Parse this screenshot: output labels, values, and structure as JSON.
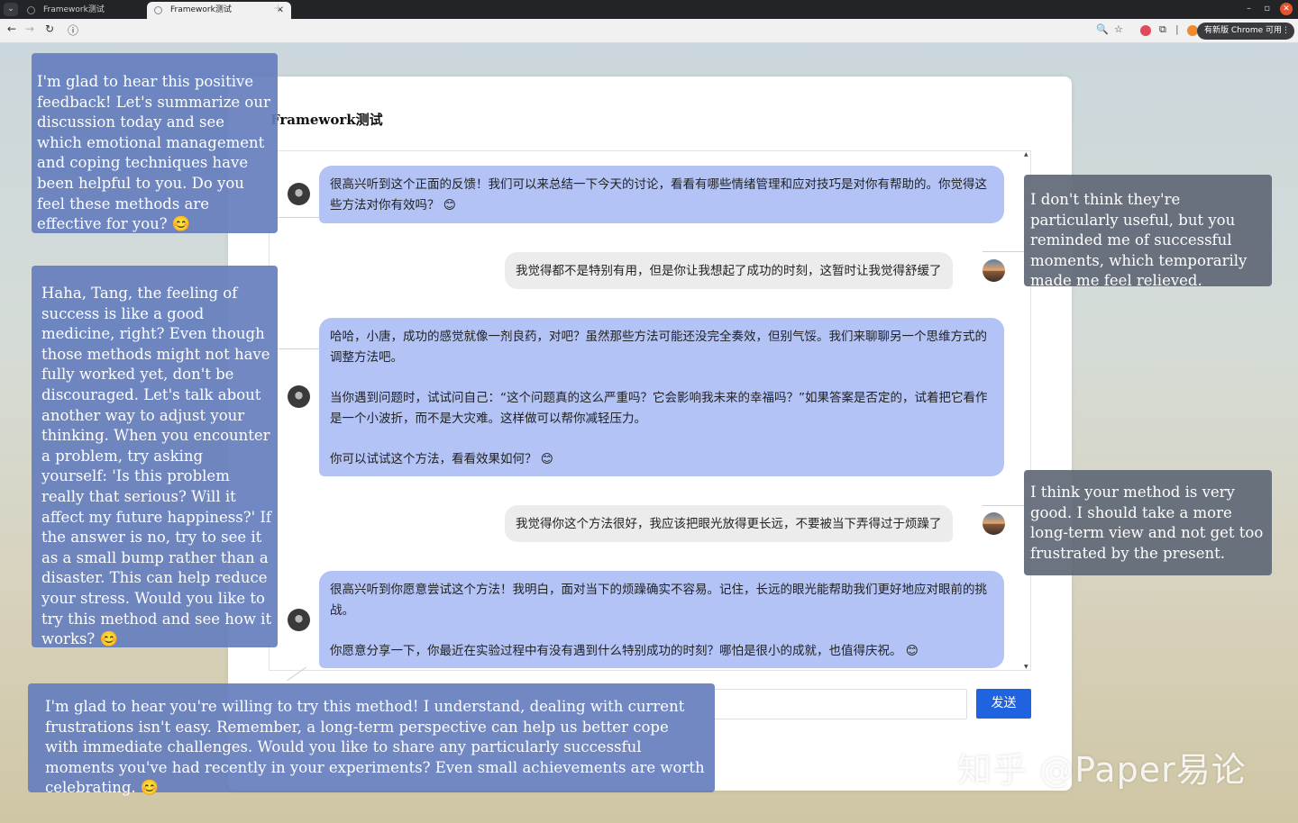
{
  "browser": {
    "tabs": [
      {
        "title": "Framework测试",
        "active": false
      },
      {
        "title": "Framework测试",
        "active": true
      }
    ],
    "update_pill": "有新版 Chrome 可用"
  },
  "page": {
    "title": "Framework测试",
    "send_label": "发送",
    "input_value": ""
  },
  "messages": [
    {
      "role": "bot",
      "paragraphs": [
        "很高兴听到这个正面的反馈！我们可以来总结一下今天的讨论，看看有哪些情绪管理和应对技巧是对你有帮助的。你觉得这些方法对你有效吗？ 😊"
      ]
    },
    {
      "role": "user",
      "paragraphs": [
        "我觉得都不是特别有用，但是你让我想起了成功的时刻，这暂时让我觉得舒缓了"
      ]
    },
    {
      "role": "bot",
      "paragraphs": [
        "哈哈，小唐，成功的感觉就像一剂良药，对吧？虽然那些方法可能还没完全奏效，但别气馁。我们来聊聊另一个思维方式的调整方法吧。",
        "当你遇到问题时，试试问自己：“这个问题真的这么严重吗？它会影响我未来的幸福吗？”如果答案是否定的，试着把它看作是一个小波折，而不是大灾难。这样做可以帮你减轻压力。",
        "你可以试试这个方法，看看效果如何？ 😊"
      ]
    },
    {
      "role": "user",
      "paragraphs": [
        "我觉得你这个方法很好，我应该把眼光放得更长远，不要被当下弄得过于烦躁了"
      ]
    },
    {
      "role": "bot",
      "paragraphs": [
        "很高兴听到你愿意尝试这个方法！我明白，面对当下的烦躁确实不容易。记住，长远的眼光能帮助我们更好地应对眼前的挑战。",
        "你愿意分享一下，你最近在实验过程中有没有遇到什么特别成功的时刻？哪怕是很小的成就，也值得庆祝。 😊"
      ]
    }
  ],
  "annotations": [
    {
      "kind": "blue",
      "text": "I'm glad to hear this positive feedback! Let's summarize our discussion today and see which emotional management and coping techniques have been helpful to you. Do you feel these methods are effective for you? 😊"
    },
    {
      "kind": "gray",
      "text": "I don't think they're particularly useful, but you reminded me of successful moments, which temporarily made me feel relieved."
    },
    {
      "kind": "blue",
      "text": "Haha, Tang, the feeling of success is like a good medicine, right? Even though those methods might not have fully worked yet, don't be discouraged. Let's talk about another way to adjust your thinking. When you encounter a problem, try asking yourself: 'Is this problem really that serious? Will it affect my future happiness?' If the answer is no, try to see it as a small bump rather than a disaster. This can help reduce your stress. Would you like to try this method and see how it works? 😊"
    },
    {
      "kind": "gray",
      "text": "I think your method is very good. I should take a more long-term view and not get too frustrated by the present."
    },
    {
      "kind": "blue",
      "text": "I'm glad to hear you're willing to try this method! I understand, dealing with current frustrations isn't easy. Remember, a long-term perspective can help us better cope with immediate challenges. Would you like to share any particularly successful moments you've had recently in your experiments? Even small achievements are worth celebrating. 😊"
    }
  ],
  "watermark": "知乎 @Paper易论",
  "colors": {
    "bot_bubble": "#b3c3f5",
    "user_bubble": "#ececec",
    "send_button": "#1f63e0",
    "annotation_blue": "#657ebd",
    "annotation_gray": "#5f6876"
  }
}
